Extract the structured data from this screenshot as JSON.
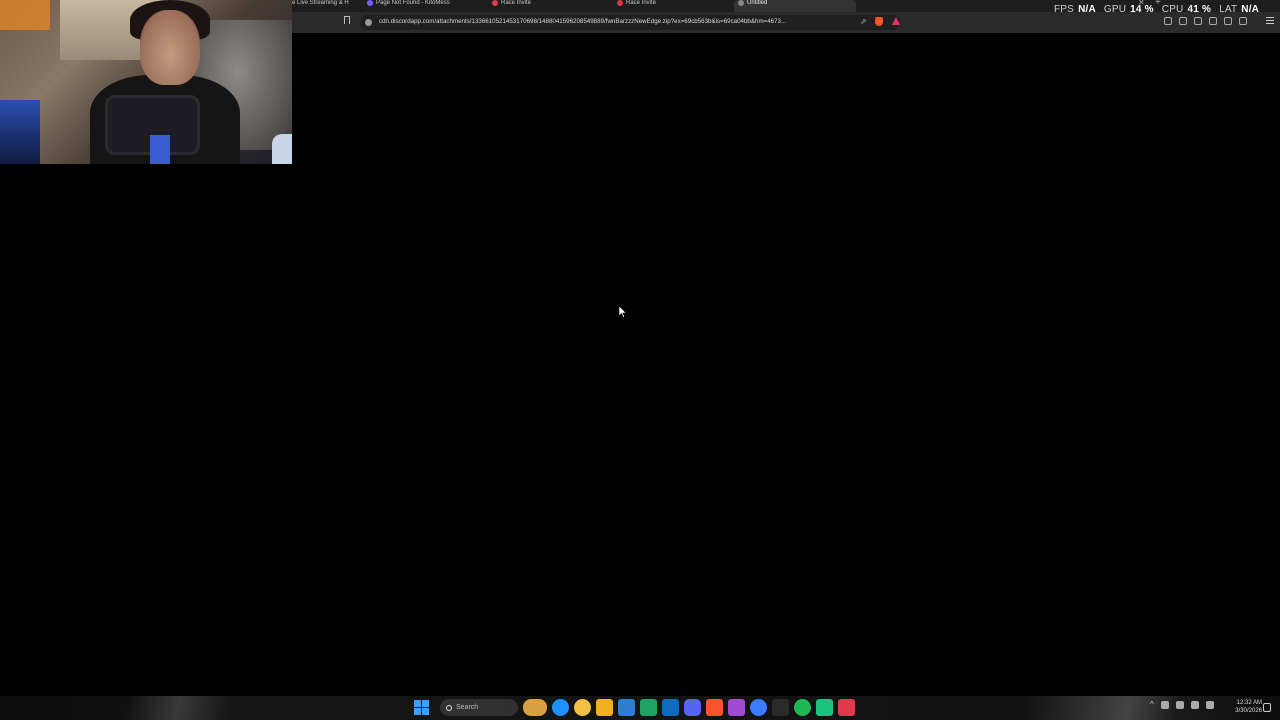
{
  "browser": {
    "tabs": [
      {
        "title": "e Live Streaming & H",
        "favicon_color": "#9a9a9a"
      },
      {
        "title": "Page Not Found - KitoMess",
        "favicon_color": "#7b5cff"
      },
      {
        "title": "Race Invite",
        "favicon_color": "#e03a4a"
      },
      {
        "title": "Race Invite",
        "favicon_color": "#e03a4a"
      },
      {
        "title": "Untitled",
        "favicon_color": "#8a8a8a",
        "active": true
      }
    ],
    "url": "cdn.discordapp.com/attachments/1336610521453170698/1488041596208549889/fwnBarzzzNewEdge.zip?ex=69cb563b&is=69ca04bb&hm=4673..."
  },
  "perf_overlay": {
    "fps_label": "FPS",
    "fps_value": "N/A",
    "gpu_label": "GPU",
    "gpu_value": "14 %",
    "cpu_label": "CPU",
    "cpu_value": "41 %",
    "lat_label": "LAT",
    "lat_value": "N/A"
  },
  "taskbar": {
    "search_placeholder": "Search",
    "clock_time": "12:32 AM",
    "clock_date": "3/30/2026",
    "app_icon_colors": [
      "#d8a040",
      "#1e90ff",
      "#f0c040",
      "#f0b020",
      "#2d7dd2",
      "#21a366",
      "#0f6cbd",
      "#5865f2",
      "#fb542b",
      "#a04bd0",
      "#3a7bff",
      "#2a2a2a",
      "#1db954",
      "#19c37d",
      "#e03a4a"
    ]
  },
  "colors": {
    "background": "#000000",
    "accent_blue": "#3fa0ff"
  }
}
